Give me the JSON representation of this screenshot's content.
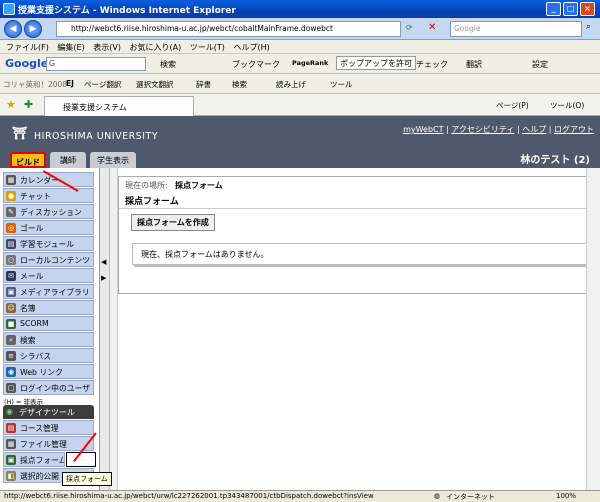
{
  "window": {
    "title": "授業支援システム - Windows Internet Explorer"
  },
  "address": {
    "url": "http://webct6.riise.hiroshima-u.ac.jp/webct/cobaltMainFrame.dowebct",
    "search_placeholder": "Google"
  },
  "menu": [
    "ファイル(F)",
    "編集(E)",
    "表示(V)",
    "お気に入り(A)",
    "ツール(T)",
    "ヘルプ(H)"
  ],
  "google_bar": {
    "logo": "Google",
    "input": "G",
    "items": [
      "検索",
      "ブックマーク",
      "PageRank",
      "ポップアップを許可",
      "チェック",
      "翻訳",
      "設定"
    ]
  },
  "links_bar": {
    "items": [
      "コリャ英和！2008",
      "EJ",
      "ページ翻訳",
      "選択文翻訳",
      "辞書",
      "検索",
      "読み上げ",
      "ツール"
    ]
  },
  "browser_tab": {
    "label": "授業支援システム",
    "tools": [
      "ページ(P)",
      "ツール(O)"
    ]
  },
  "header": {
    "university": "HIROSHIMA UNIVERSITY",
    "links": [
      "myWebCT",
      "アクセシビリティ",
      "ヘルプ",
      "ログアウト"
    ],
    "tabs": [
      "ビルド",
      "講師",
      "学生表示"
    ],
    "course": "林のテスト (2)"
  },
  "sidebar": {
    "items": [
      "カレンダー",
      "チャット",
      "ディスカッション",
      "ゴール",
      "学習モジュール",
      "ローカルコンテンツ",
      "メール",
      "メディアライブラリ",
      "名簿",
      "SCORM",
      "検索",
      "シラバス",
      "Web リンク",
      "ログイン中のユーザ"
    ],
    "hidden_note": "(H) = 非表示",
    "design_tools_header": "デザイナツール",
    "tools": [
      "コース管理",
      "ファイル管理",
      "採点フォーム",
      "選択的公開"
    ],
    "tooltip": "採点フォーム"
  },
  "main": {
    "breadcrumb_label": "現在の場所:",
    "breadcrumb_value": "採点フォーム",
    "page_title": "採点フォーム",
    "create_button": "採点フォームを作成",
    "empty_notice": "現在、採点フォームはありません。"
  },
  "status": {
    "url": "http://webct6.riise.hiroshima-u.ac.jp/webct/urw/lc227262001.tp343487001/ctbDispatch.dowebct?insView",
    "zone": "インターネット",
    "zoom": "100%"
  },
  "colors": {
    "header_bg": "#4e5a6b",
    "active_tab": "#f0c020",
    "sidebar_item": "#c5d3ef",
    "annotation": "#ff0000"
  }
}
